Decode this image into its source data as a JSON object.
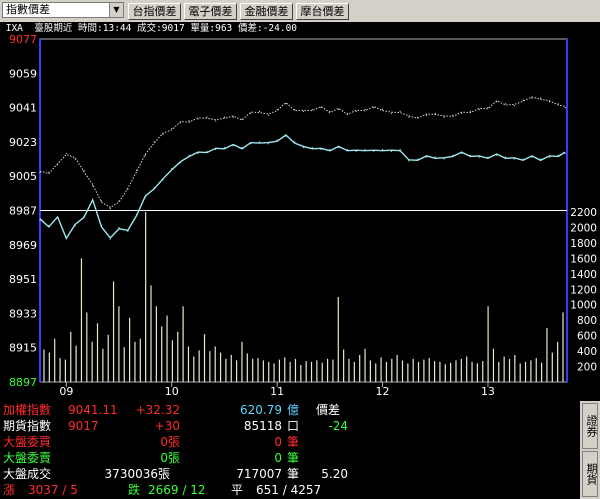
{
  "toolbar": {
    "index_select": "指數價差",
    "buttons": [
      "台指價差",
      "電子價差",
      "金融價差",
      "摩台價差"
    ]
  },
  "info_line": " IXA  臺股期近 時間:13:44 成交:9017 單量:963 價差:-24.00",
  "chart_data": {
    "type": "line",
    "price_axis": {
      "ticks": [
        "9077",
        "9059",
        "9041",
        "9023",
        "9005",
        "8987",
        "8969",
        "8951",
        "8933",
        "8915",
        "8897"
      ],
      "top": 9077,
      "bottom": 8897,
      "highlight_top": "9077",
      "highlight_bottom": "8897"
    },
    "volume_axis": {
      "ticks": [
        "2200",
        "2000",
        "1800",
        "1600",
        "1400",
        "1200",
        "1000",
        "800",
        "600",
        "400",
        "200"
      ],
      "max": 2200
    },
    "reference_level": 8987,
    "time_ticks": [
      "09",
      "10",
      "11",
      "12",
      "13"
    ],
    "time_range": [
      "08:45",
      "13:45"
    ],
    "series": [
      {
        "color": "#9fe7f0",
        "style": "solid",
        "x": [
          "08:45",
          "08:50",
          "08:55",
          "09:00",
          "09:05",
          "09:10",
          "09:15",
          "09:20",
          "09:25",
          "09:30",
          "09:35",
          "09:40",
          "09:45",
          "09:50",
          "09:55",
          "10:00",
          "10:05",
          "10:10",
          "10:15",
          "10:20",
          "10:25",
          "10:30",
          "10:35",
          "10:40",
          "10:45",
          "10:50",
          "10:55",
          "11:00",
          "11:05",
          "11:10",
          "11:15",
          "11:20",
          "11:25",
          "11:30",
          "11:35",
          "11:40",
          "11:45",
          "11:50",
          "11:55",
          "12:00",
          "12:05",
          "12:10",
          "12:15",
          "12:20",
          "12:25",
          "12:30",
          "12:35",
          "12:40",
          "12:45",
          "12:50",
          "12:55",
          "13:00",
          "13:05",
          "13:10",
          "13:15",
          "13:20",
          "13:25",
          "13:30",
          "13:35",
          "13:40",
          "13:44"
        ],
        "y": [
          8982,
          8979,
          8983,
          8973,
          8979,
          8984,
          8992,
          8979,
          8972,
          8978,
          8976,
          8985,
          8994,
          8999,
          9003,
          9009,
          9012,
          9016,
          9017,
          9018,
          9019,
          9020,
          9021,
          9020,
          9022,
          9023,
          9022,
          9024,
          9026,
          9023,
          9020,
          9020,
          9019,
          9019,
          9020,
          9019,
          9018,
          9019,
          9018,
          9019,
          9018,
          9019,
          9013,
          9014,
          9015,
          9015,
          9014,
          9016,
          9017,
          9016,
          9015,
          9015,
          9016,
          9015,
          9014,
          9014,
          9015,
          9014,
          9015,
          9016,
          9017
        ]
      },
      {
        "color": "#d8d8d8",
        "style": "dotted",
        "x": [
          "08:45",
          "08:50",
          "08:55",
          "09:00",
          "09:05",
          "09:10",
          "09:15",
          "09:20",
          "09:25",
          "09:30",
          "09:35",
          "09:40",
          "09:45",
          "09:50",
          "09:55",
          "10:00",
          "10:05",
          "10:10",
          "10:15",
          "10:20",
          "10:25",
          "10:30",
          "10:35",
          "10:40",
          "10:45",
          "10:50",
          "10:55",
          "11:00",
          "11:05",
          "11:10",
          "11:15",
          "11:20",
          "11:25",
          "11:30",
          "11:35",
          "11:40",
          "11:45",
          "11:50",
          "11:55",
          "12:00",
          "12:05",
          "12:10",
          "12:15",
          "12:20",
          "12:25",
          "12:30",
          "12:35",
          "12:40",
          "12:45",
          "12:50",
          "12:55",
          "13:00",
          "13:05",
          "13:10",
          "13:15",
          "13:20",
          "13:25",
          "13:30",
          "13:35",
          "13:40",
          "13:44"
        ],
        "y": [
          9007,
          9007,
          9011,
          9017,
          9014,
          9008,
          9000,
          8992,
          8988,
          8992,
          8998,
          9008,
          9016,
          9023,
          9027,
          9030,
          9033,
          9034,
          9035,
          9036,
          9034,
          9036,
          9036,
          9035,
          9038,
          9039,
          9037,
          9040,
          9043,
          9040,
          9039,
          9040,
          9041,
          9039,
          9040,
          9038,
          9039,
          9040,
          9041,
          9040,
          9038,
          9039,
          9036,
          9036,
          9037,
          9038,
          9036,
          9037,
          9038,
          9039,
          9040,
          9041,
          9044,
          9043,
          9042,
          9045,
          9046,
          9046,
          9044,
          9043,
          9041
        ]
      }
    ],
    "volume": [
      420,
      380,
      560,
      310,
      290,
      650,
      470,
      1600,
      900,
      520,
      760,
      430,
      610,
      1300,
      980,
      450,
      830,
      520,
      560,
      2200,
      1250,
      980,
      720,
      860,
      540,
      650,
      980,
      460,
      330,
      410,
      620,
      400,
      460,
      380,
      300,
      350,
      280,
      520,
      370,
      300,
      310,
      280,
      260,
      240,
      290,
      320,
      260,
      300,
      220,
      270,
      260,
      280,
      250,
      300,
      290,
      1100,
      420,
      300,
      260,
      350,
      430,
      280,
      240,
      320,
      260,
      300,
      350,
      280,
      240,
      300,
      260,
      290,
      310,
      270,
      260,
      230,
      250,
      280,
      300,
      330,
      260,
      240,
      270,
      980,
      430,
      260,
      330,
      300,
      350,
      240,
      260,
      280,
      310,
      250,
      700,
      380,
      520,
      900
    ]
  },
  "quotes": [
    {
      "name": "加權指數",
      "price": "9041.11",
      "change": "+32.32",
      "amount": "620.79",
      "unit": "億",
      "label": "價差",
      "label_value": "",
      "name_color": "#ff2a2a",
      "price_color": "#ff2a2a",
      "change_color": "#ff2a2a",
      "amount_color": "#5fd7ff"
    },
    {
      "name": "期貨指數",
      "price": "9017",
      "change": "+30",
      "amount": "85118",
      "unit": "口",
      "label": "",
      "label_value": "-24",
      "name_color": "#ffffff",
      "price_color": "#ff2a2a",
      "change_color": "#ff2a2a",
      "amount_color": "#ffffff"
    },
    {
      "name": "大盤委買",
      "price": "",
      "change": "0張",
      "amount": "0",
      "unit": "筆",
      "label": "",
      "label_value": "",
      "name_color": "#ff2a2a",
      "price_color": "#ff2a2a",
      "change_color": "#ff2a2a",
      "amount_color": "#ff2a2a"
    },
    {
      "name": "大盤委賣",
      "price": "",
      "change": "0張",
      "amount": "0",
      "unit": "筆",
      "label": "",
      "label_value": "",
      "name_color": "#39ff39",
      "price_color": "#39ff39",
      "change_color": "#39ff39",
      "amount_color": "#39ff39"
    },
    {
      "name": "大盤成交",
      "price": "3730036",
      "change": "張",
      "amount": "717007",
      "unit": "筆",
      "label": "",
      "label_value": "5.20",
      "name_color": "#ffffff",
      "price_color": "#ffffff",
      "change_color": "#ffffff",
      "amount_color": "#ffffff"
    }
  ],
  "breadth": {
    "up_label": "漲",
    "up_value": "3037 / 5",
    "down_label": "跌",
    "down_value": "2669 / 12",
    "flat_label": "平",
    "flat_value": "651 / 4257"
  },
  "side_tabs": [
    "證券",
    "期貨"
  ],
  "colors": {
    "background": "#000000",
    "frame": "#b0b0b0",
    "price_line": "#9fe7f0",
    "futures_line": "#d8d8d8",
    "volume_bar": "#e8e8c8",
    "axis_divider": "#3a3aff",
    "reference": "#ffffff",
    "up": "#ff2a2a",
    "down": "#39ff39"
  }
}
